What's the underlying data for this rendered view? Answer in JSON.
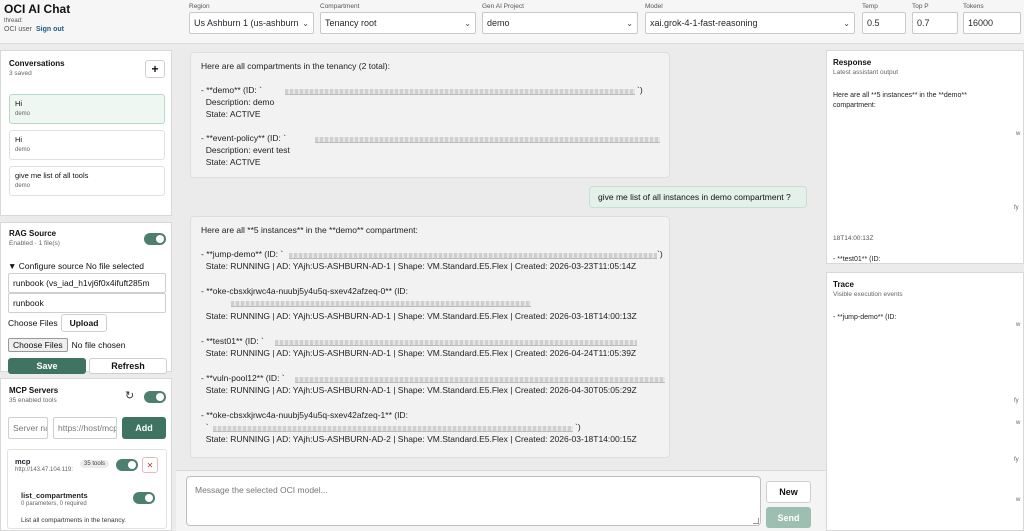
{
  "app": {
    "title": "OCI AI Chat",
    "thread": "thread: ",
    "user": "OCI user",
    "signout": "Sign out"
  },
  "controls": {
    "region": {
      "label": "Region",
      "value": "Us Ashburn 1 (us-ashburn-1)"
    },
    "compartment": {
      "label": "Compartment",
      "value": "Tenancy root"
    },
    "project": {
      "label": "Gen AI Project",
      "value": "demo"
    },
    "model": {
      "label": "Model",
      "value": "xai.grok-4-1-fast-reasoning"
    },
    "temp": {
      "label": "Temp",
      "value": "0.5"
    },
    "top_p": {
      "label": "Top P",
      "value": "0.7"
    },
    "tokens": {
      "label": "Tokens",
      "value": "16000"
    }
  },
  "conversations": {
    "title": "Conversations",
    "count": "3 saved",
    "add": "+",
    "items": [
      {
        "title": "Hi",
        "sub": "demo"
      },
      {
        "title": "Hi",
        "sub": "demo"
      },
      {
        "title": "give me list of all tools",
        "sub": "demo"
      }
    ]
  },
  "rag": {
    "title": "RAG Source",
    "status": "Enabled · 1 file(s)",
    "configure": "▼ Configure source No file selected",
    "source": "runbook (vs_iad_h1vj6f0x4ifuft285m",
    "name": "runbook",
    "choose_files_label": "Choose Files",
    "upload": "Upload",
    "choose_files_btn": "Choose Files",
    "no_file": "No file chosen",
    "save": "Save",
    "refresh": "Refresh"
  },
  "mcp": {
    "title": "MCP Servers",
    "status": "35 enabled tools",
    "refresh_icon": "↻",
    "server_placeholder": "Server name",
    "url_placeholder": "https://host/mcp",
    "add": "Add",
    "server_name": "mcp",
    "server_url": "http://143.47.104.119:",
    "tools_badge": "35 tools",
    "remove": "✕",
    "tool_name": "list_compartments",
    "tool_params": "0 parameters, 0 required",
    "tool_desc": "List all compartments in the tenancy."
  },
  "chat": {
    "m1": {
      "l1": "Here are all compartments in the tenancy (2 total):",
      "l2": "- **demo** (ID: `",
      "l2end": "`)",
      "l3": "  Description: demo",
      "l4": "  State: ACTIVE",
      "l5": "- **event-policy** (ID: `",
      "l6": "  Description: event test",
      "l7": "  State: ACTIVE"
    },
    "user_msg": "give me list of all instances in demo compartment ?",
    "m2": {
      "l1": "Here are all **5 instances** in the **demo** compartment:",
      "l2": "- **jump-demo** (ID: `",
      "l2end": "`)",
      "l3": "  State: RUNNING | AD: YAjh:US-ASHBURN-AD-1 | Shape: VM.Standard.E5.Flex | Created: 2026-03-23T11:05:14Z",
      "l4": "- **oke-cbsxkjrwc4a-nuubj5y4u5q-sxev42afzeq-0** (ID:",
      "l5": "  State: RUNNING | AD: YAjh:US-ASHBURN-AD-1 | Shape: VM.Standard.E5.Flex | Created: 2026-03-18T14:00:13Z",
      "l6": "- **test01** (ID: `",
      "l7": "  State: RUNNING | AD: YAjh:US-ASHBURN-AD-1 | Shape: VM.Standard.E5.Flex | Created: 2026-04-24T11:05:39Z",
      "l8": "- **vuln-pool12** (ID: `",
      "l9": "  State: RUNNING | AD: YAjh:US-ASHBURN-AD-1 | Shape: VM.Standard.E5.Flex | Created: 2026-04-30T05:05:29Z",
      "l10": "- **oke-cbsxkjrwc4a-nuubj5y4u5q-sxev42afzeq-1** (ID:",
      "l11": "  `",
      "l11end": "`)",
      "l12": "  State: RUNNING | AD: YAjh:US-ASHBURN-AD-2 | Shape: VM.Standard.E5.Flex | Created: 2026-03-18T14:00:15Z"
    },
    "placeholder": "Message the selected OCI model...",
    "new": "New",
    "send": "Send"
  },
  "response": {
    "title": "Response",
    "sub": "Latest assistant output",
    "line1": "Here are all **5 instances** in the **demo**",
    "line2": "compartment:",
    "frag1": "18T14:00:13Z",
    "frag2": "- **test01** (ID:"
  },
  "trace": {
    "title": "Trace",
    "sub": "Visible execution events",
    "line1": "- **jump-demo** (ID:"
  },
  "edge_fragments": [
    "w",
    "fy",
    "w",
    "fy",
    "w",
    "fy",
    "w"
  ]
}
